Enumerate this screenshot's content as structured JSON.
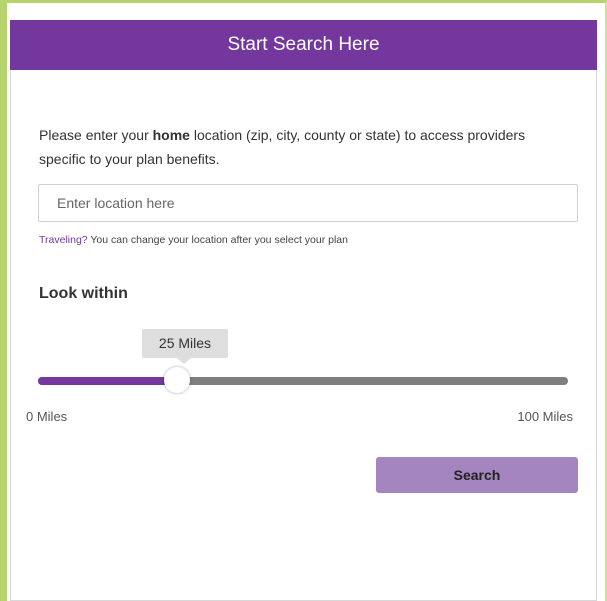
{
  "header": {
    "title": "Start Search Here"
  },
  "intro": {
    "text_before": "Please enter your ",
    "emphasis": "home",
    "text_after": " location (zip, city, county or state) to access providers specific to your plan benefits."
  },
  "location": {
    "placeholder": "Enter location here",
    "value": ""
  },
  "travel_note": {
    "link_text": "Traveling?",
    "text": " You can change your location after you select your plan"
  },
  "distance": {
    "heading": "Look within",
    "selected_label": "25 Miles",
    "value": 25,
    "min": 0,
    "max": 100,
    "min_label": "0 Miles",
    "max_label": "100 Miles"
  },
  "actions": {
    "search_label": "Search"
  },
  "colors": {
    "brand_purple": "#74379d",
    "button_purple": "#a585c0",
    "track_gray": "#7f7f7f",
    "frame_green": "#b7d36b"
  }
}
